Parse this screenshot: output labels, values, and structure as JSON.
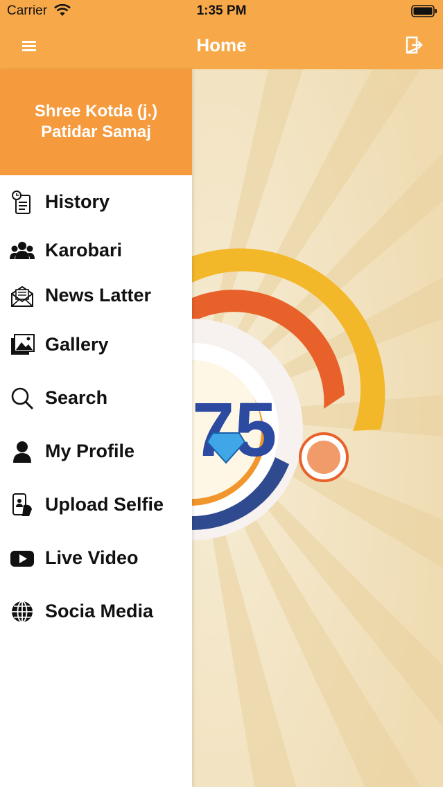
{
  "status_bar": {
    "carrier": "Carrier",
    "time": "1:35 PM"
  },
  "nav": {
    "title": "Home",
    "left_icon": "hamburger-menu-icon",
    "right_icon": "logout-icon"
  },
  "drawer": {
    "header": {
      "line1": "Shree Kotda (j.)",
      "line2": "Patidar Samaj"
    },
    "items": [
      {
        "label": "History",
        "icon": "history-icon"
      },
      {
        "label": "Karobari",
        "icon": "group-icon"
      },
      {
        "label": "News Latter",
        "icon": "newsletter-icon"
      },
      {
        "label": "Gallery",
        "icon": "gallery-icon"
      },
      {
        "label": "Search",
        "icon": "search-icon"
      },
      {
        "label": "My Profile",
        "icon": "profile-icon"
      },
      {
        "label": "Upload Selfie",
        "icon": "selfie-icon"
      },
      {
        "label": "Live Video",
        "icon": "video-play-icon"
      },
      {
        "label": "Socia Media",
        "icon": "globe-icon"
      }
    ]
  },
  "colors": {
    "header_bar": "#f7a94a",
    "drawer_header": "#f59a3d",
    "background": "#f4e7c9"
  }
}
